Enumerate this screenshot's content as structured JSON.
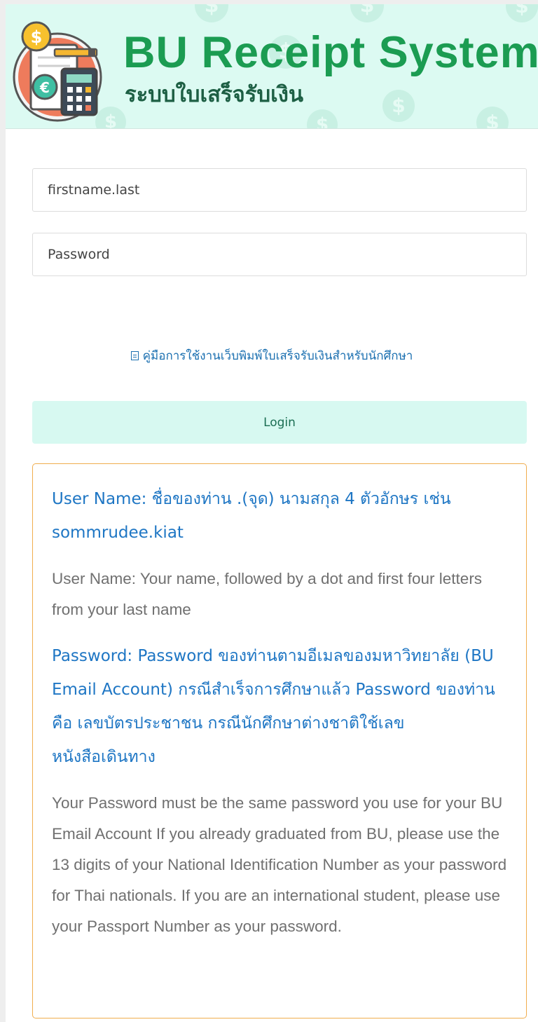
{
  "header": {
    "title": "BU Receipt System",
    "subtitle": "ระบบใบเสร็จรับเงิน",
    "logo_icon": "receipt-calculator-logo",
    "colors": {
      "title": "#1b9c52",
      "subtitle": "#1d5f44",
      "background": "#dcfaf2"
    }
  },
  "form": {
    "username_placeholder": "firstname.last",
    "password_placeholder": "Password",
    "manual_link": "คู่มือการใช้งานเว็บพิมพ์ใบเสร็จรับเงินสำหรับนักศึกษา",
    "manual_icon": "file-icon",
    "login_label": "Login",
    "colors": {
      "login_button": "#d7f9f1",
      "link": "#1a6fb0"
    }
  },
  "info": {
    "username_thai": "User Name: ชื่อของท่าน .(จุด) นามสกุล 4 ตัวอักษร เช่น sommrudee.kiat",
    "username_english": "User Name: Your name, followed by a dot and first four letters from your last name",
    "password_thai": "Password: Password ของท่านตามอีเมลของมหาวิทยาลัย (BU Email Account) กรณีสำเร็จการศึกษาแล้ว Password ของท่าน คือ เลขบัตรประชาชน กรณีนักศึกษาต่างชาติใช้เลขหนังสือเดินทาง",
    "password_english": "Your Password must be the same password you use for your BU Email Account If you already graduated from BU, please use the 13 digits of your National Identification Number as your password for Thai nationals. If you are an international student, please use your Passport Number as your password.",
    "colors": {
      "border": "#f0ad4e",
      "thai_text": "#1e76c4",
      "english_text": "#707070"
    }
  }
}
